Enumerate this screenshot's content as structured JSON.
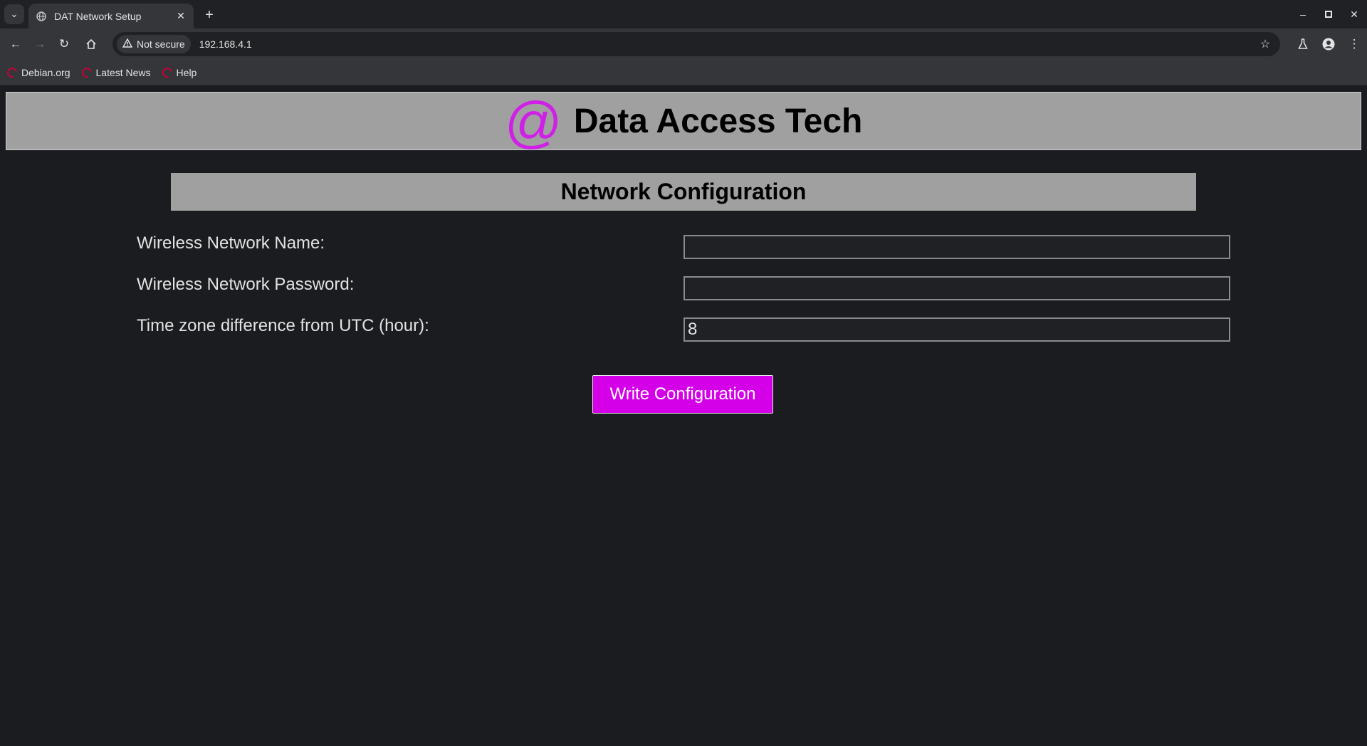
{
  "browser": {
    "tab_title": "DAT Network Setup",
    "new_tab_symbol": "+",
    "security_label": "Not secure",
    "url": "192.168.4.1",
    "bookmarks": [
      {
        "label": "Debian.org",
        "icon": "debian-icon"
      },
      {
        "label": "Latest News",
        "icon": "debian-icon"
      },
      {
        "label": "Help",
        "icon": "debian-icon"
      }
    ]
  },
  "header": {
    "logo_symbol": "@",
    "brand_name": "Data Access Tech"
  },
  "section": {
    "title": "Network Configuration"
  },
  "form": {
    "fields": [
      {
        "label": "Wireless Network Name:",
        "value": ""
      },
      {
        "label": "Wireless Network Password:",
        "value": ""
      },
      {
        "label": "Time zone difference from UTC (hour):",
        "value": "8"
      }
    ],
    "submit_label": "Write Configuration"
  },
  "colors": {
    "accent": "#d400e8",
    "banner": "#a0a0a0",
    "background": "#1b1c1f"
  }
}
